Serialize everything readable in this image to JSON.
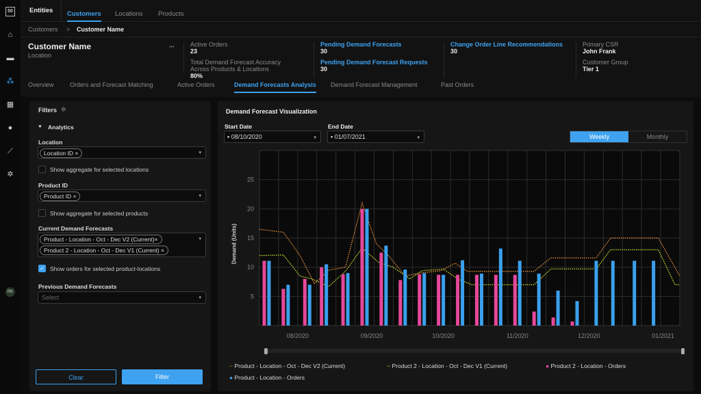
{
  "nav": {
    "logo": "50",
    "icons": [
      "home-icon",
      "truck-icon",
      "network-icon",
      "calendar-icon",
      "lightbulb-icon",
      "chart-icon",
      "gear-icon"
    ],
    "avatar": "RK"
  },
  "topbar": {
    "section": "Entities",
    "tabs": [
      "Customers",
      "Locations",
      "Products"
    ],
    "active_tab": "Customers"
  },
  "breadcrumb": {
    "parent": "Customers",
    "sep": ">",
    "current": "Customer Name"
  },
  "customer": {
    "name": "Customer Name",
    "location": "Location",
    "more": "..."
  },
  "stats": {
    "active_orders_label": "Active Orders",
    "active_orders": "23",
    "accuracy_label": "Total Demand Forecast Accuracy Across Products & Locations",
    "accuracy": "80%",
    "pending_forecasts_label": "Pending Demand Forecasts",
    "pending_forecasts": "30",
    "pending_requests_label": "Pending Demand Forecast Requests",
    "pending_requests": "30",
    "change_order_label": "Change Order Line Recommendations",
    "change_order": "30",
    "csr_label": "Primary CSR",
    "csr": "John Frank",
    "group_label": "Customer Group",
    "group": "Tier 1"
  },
  "tabs": [
    "Overview",
    "Orders and Forecast Matching",
    "Active Orders",
    "Demand Forecasts Analysis",
    "Demand Forecast Management",
    "Past Orders"
  ],
  "filters": {
    "title": "Filters",
    "section": "Analytics",
    "location_label": "Location",
    "location_chip": "Location ID ×",
    "agg_locations": "Show aggregate for selected locations",
    "product_label": "Product ID",
    "product_chip": "Product ID  ×",
    "agg_products": "Show aggregate for selected products",
    "current_label": "Current Demand Forecasts",
    "current_chips": [
      "Product - Location - Oct - Dec V2 (Current)×",
      "Product 2 - Location - Oct - Dec V1 (Current) ×"
    ],
    "show_orders": "Show orders for selected product-locations",
    "show_orders_checked": true,
    "previous_label": "Previous Demand Forecasts",
    "previous_placeholder": "Select",
    "clear": "Clear",
    "filter": "Filter"
  },
  "viz": {
    "title": "Demand Forecast Visualization",
    "start_label": "Start Date",
    "start": "08/10/2020",
    "end_label": "End Date",
    "end": "01/07/2021",
    "weekly": "Weekly",
    "monthly": "Monthly",
    "active_period": "Weekly"
  },
  "chart_data": {
    "type": "bar+line",
    "ylabel": "Demand (Units)",
    "ylim": [
      0,
      30
    ],
    "yticks": [
      5,
      10,
      15,
      20,
      25
    ],
    "grid": true,
    "legend": "bottom",
    "xlim": [
      "2020-07-16",
      "2021-01-08"
    ],
    "xticks": [
      {
        "date": "2020-08-01",
        "label": "08/2020"
      },
      {
        "date": "2020-09-01",
        "label": "09/2020"
      },
      {
        "date": "2020-10-01",
        "label": "10/2020"
      },
      {
        "date": "2020-11-01",
        "label": "11/2020"
      },
      {
        "date": "2020-12-01",
        "label": "12/2020"
      },
      {
        "date": "2021-01-01",
        "label": "01/2021"
      }
    ],
    "series": [
      {
        "name": "Product - Location - Oct - Dec V2 (Current)",
        "kind": "dotted-line",
        "color": "#e08a3c",
        "points": [
          [
            "2020-07-16",
            16.5
          ],
          [
            "2020-07-26",
            16
          ],
          [
            "2020-08-02",
            12
          ],
          [
            "2020-08-08",
            7.2
          ],
          [
            "2020-08-14",
            9.5
          ],
          [
            "2020-08-21",
            10
          ],
          [
            "2020-08-28",
            21
          ],
          [
            "2020-09-03",
            14
          ],
          [
            "2020-09-08",
            12
          ],
          [
            "2020-09-15",
            8.5
          ],
          [
            "2020-09-21",
            9
          ],
          [
            "2020-09-30",
            9.4
          ],
          [
            "2020-10-06",
            10.7
          ],
          [
            "2020-10-11",
            9.3
          ],
          [
            "2020-11-08",
            9.3
          ],
          [
            "2020-11-15",
            11.6
          ],
          [
            "2020-12-04",
            11.6
          ],
          [
            "2020-12-10",
            15
          ],
          [
            "2020-12-30",
            15
          ],
          [
            "2021-01-08",
            8.5
          ]
        ]
      },
      {
        "name": "Product 2 - Location - Oct - Dec V1 (Current)",
        "kind": "dotted-line",
        "color": "#c8d62a",
        "points": [
          [
            "2020-07-16",
            12
          ],
          [
            "2020-07-26",
            12.1
          ],
          [
            "2020-08-02",
            8.5
          ],
          [
            "2020-08-07",
            8
          ],
          [
            "2020-08-14",
            6.7
          ],
          [
            "2020-08-21",
            9.3
          ],
          [
            "2020-08-28",
            13.3
          ],
          [
            "2020-09-04",
            10.8
          ],
          [
            "2020-09-10",
            10
          ],
          [
            "2020-09-17",
            8
          ],
          [
            "2020-09-22",
            9.4
          ],
          [
            "2020-10-01",
            9.7
          ],
          [
            "2020-10-07",
            8
          ],
          [
            "2020-10-13",
            7
          ],
          [
            "2020-11-08",
            7
          ],
          [
            "2020-11-15",
            9.7
          ],
          [
            "2020-12-04",
            9.7
          ],
          [
            "2020-12-10",
            13
          ],
          [
            "2020-12-30",
            13
          ],
          [
            "2021-01-06",
            7
          ],
          [
            "2021-01-08",
            7
          ]
        ]
      },
      {
        "name": "Product 2 - Location - Orders",
        "kind": "bar",
        "color": "#e5489a",
        "points": [
          [
            "2020-07-19",
            11.1
          ],
          [
            "2020-07-27",
            6.3
          ],
          [
            "2020-08-05",
            8
          ],
          [
            "2020-08-12",
            10
          ],
          [
            "2020-08-21",
            8.8
          ],
          [
            "2020-08-29",
            20
          ],
          [
            "2020-09-06",
            12.5
          ],
          [
            "2020-09-14",
            7.8
          ],
          [
            "2020-09-22",
            8.8
          ],
          [
            "2020-09-30",
            8.7
          ],
          [
            "2020-10-08",
            8.7
          ],
          [
            "2020-10-16",
            8.7
          ],
          [
            "2020-10-24",
            8.7
          ],
          [
            "2020-11-01",
            8.7
          ],
          [
            "2020-11-09",
            2.4
          ],
          [
            "2020-11-17",
            1.4
          ],
          [
            "2020-11-25",
            0.7
          ]
        ]
      },
      {
        "name": "Product - Location - Orders",
        "kind": "bar",
        "color": "#3aa0ec",
        "points": [
          [
            "2020-07-19",
            11.1
          ],
          [
            "2020-07-27",
            7
          ],
          [
            "2020-08-05",
            7
          ],
          [
            "2020-08-12",
            10.5
          ],
          [
            "2020-08-21",
            9
          ],
          [
            "2020-08-29",
            20
          ],
          [
            "2020-09-06",
            13.7
          ],
          [
            "2020-09-14",
            9.6
          ],
          [
            "2020-09-22",
            9
          ],
          [
            "2020-09-30",
            8.7
          ],
          [
            "2020-10-08",
            11.2
          ],
          [
            "2020-10-16",
            8.9
          ],
          [
            "2020-10-24",
            13.2
          ],
          [
            "2020-11-01",
            11.1
          ],
          [
            "2020-11-09",
            8.9
          ],
          [
            "2020-11-17",
            6
          ],
          [
            "2020-11-25",
            4.2
          ],
          [
            "2020-12-03",
            11.1
          ],
          [
            "2020-12-10",
            11.1
          ],
          [
            "2020-12-19",
            11.1
          ],
          [
            "2020-12-27",
            11.1
          ]
        ]
      }
    ]
  }
}
